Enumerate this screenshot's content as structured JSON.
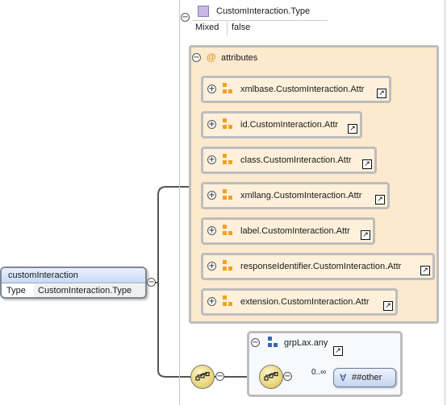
{
  "type_box": {
    "name": "CustomInteraction.Type",
    "property": {
      "key": "Mixed",
      "value": "false"
    }
  },
  "attributes_group": {
    "title": "attributes",
    "items": [
      {
        "label": "xmlbase.CustomInteraction.Attr"
      },
      {
        "label": "id.CustomInteraction.Attr"
      },
      {
        "label": "class.CustomInteraction.Attr"
      },
      {
        "label": "xmllang.CustomInteraction.Attr"
      },
      {
        "label": "label.CustomInteraction.Attr"
      },
      {
        "label": "responseIdentifier.CustomInteraction.Attr"
      },
      {
        "label": "extension.CustomInteraction.Attr"
      }
    ]
  },
  "element": {
    "name": "customInteraction",
    "type_key": "Type",
    "type_value": "CustomInteraction.Type"
  },
  "any_group": {
    "name": "grpLax.any",
    "occurrence": "0..∞",
    "wildcard": "##other"
  },
  "icons": {
    "collapse": "minus-circle-icon",
    "expand": "plus-circle-icon",
    "attribute": "attribute-icon",
    "link": "link-arrow-icon",
    "sequence": "sequence-compositor-icon",
    "forall": "forall-icon"
  },
  "colors": {
    "attribute_fill": "#fde9cd",
    "element_header": "#c8d9f5",
    "type_square": "#c9b8e6"
  }
}
